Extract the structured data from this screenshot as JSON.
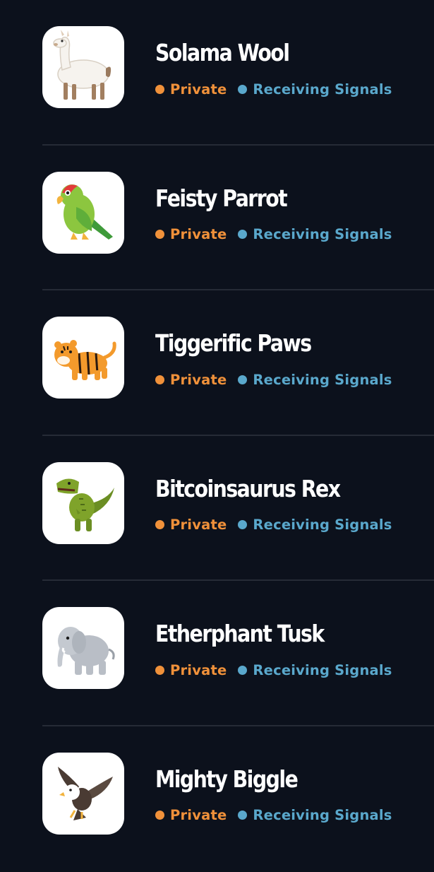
{
  "colors": {
    "background": "#0c111c",
    "private": "#f0913a",
    "signal": "#5aa8cc",
    "divider": "#262b36",
    "name": "#ffffff"
  },
  "items": [
    {
      "name": "Solama Wool",
      "privacy": "Private",
      "signal": "Receiving Signals",
      "icon": "llama-icon"
    },
    {
      "name": "Feisty Parrot",
      "privacy": "Private",
      "signal": "Receiving Signals",
      "icon": "parrot-icon"
    },
    {
      "name": "Tiggerific Paws",
      "privacy": "Private",
      "signal": "Receiving Signals",
      "icon": "tiger-icon"
    },
    {
      "name": "Bitcoinsaurus Rex",
      "privacy": "Private",
      "signal": "Receiving Signals",
      "icon": "t-rex-icon"
    },
    {
      "name": "Etherphant Tusk",
      "privacy": "Private",
      "signal": "Receiving Signals",
      "icon": "elephant-icon"
    },
    {
      "name": "Mighty Biggle",
      "privacy": "Private",
      "signal": "Receiving Signals",
      "icon": "eagle-icon"
    }
  ]
}
